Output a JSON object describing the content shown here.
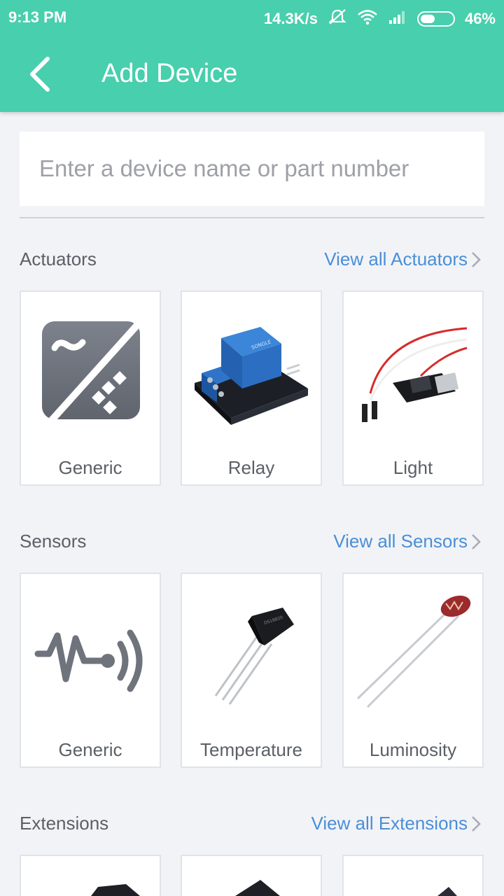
{
  "status_bar": {
    "time": "9:13 PM",
    "speed": "14.3K/s",
    "battery": "46%",
    "battery_level": 0.46
  },
  "header": {
    "title": "Add Device"
  },
  "search": {
    "placeholder": "Enter a device name or part number",
    "value": ""
  },
  "sections": [
    {
      "title": "Actuators",
      "view_all": "View all Actuators",
      "items": [
        {
          "label": "Generic",
          "icon": "generic-actuator-icon"
        },
        {
          "label": "Relay",
          "icon": "relay-module-image"
        },
        {
          "label": "Light",
          "icon": "light-module-image"
        }
      ]
    },
    {
      "title": "Sensors",
      "view_all": "View all Sensors",
      "items": [
        {
          "label": "Generic",
          "icon": "generic-sensor-icon"
        },
        {
          "label": "Temperature",
          "icon": "temperature-sensor-image"
        },
        {
          "label": "Luminosity",
          "icon": "photoresistor-image"
        }
      ]
    },
    {
      "title": "Extensions",
      "view_all": "View all Extensions",
      "items": [
        {
          "label": "",
          "icon": "extension-image"
        },
        {
          "label": "",
          "icon": "extension-image"
        },
        {
          "label": "",
          "icon": "extension-image"
        }
      ]
    }
  ],
  "colors": {
    "accent": "#48cfad",
    "link": "#4a8fd6",
    "background": "#f2f3f7"
  }
}
